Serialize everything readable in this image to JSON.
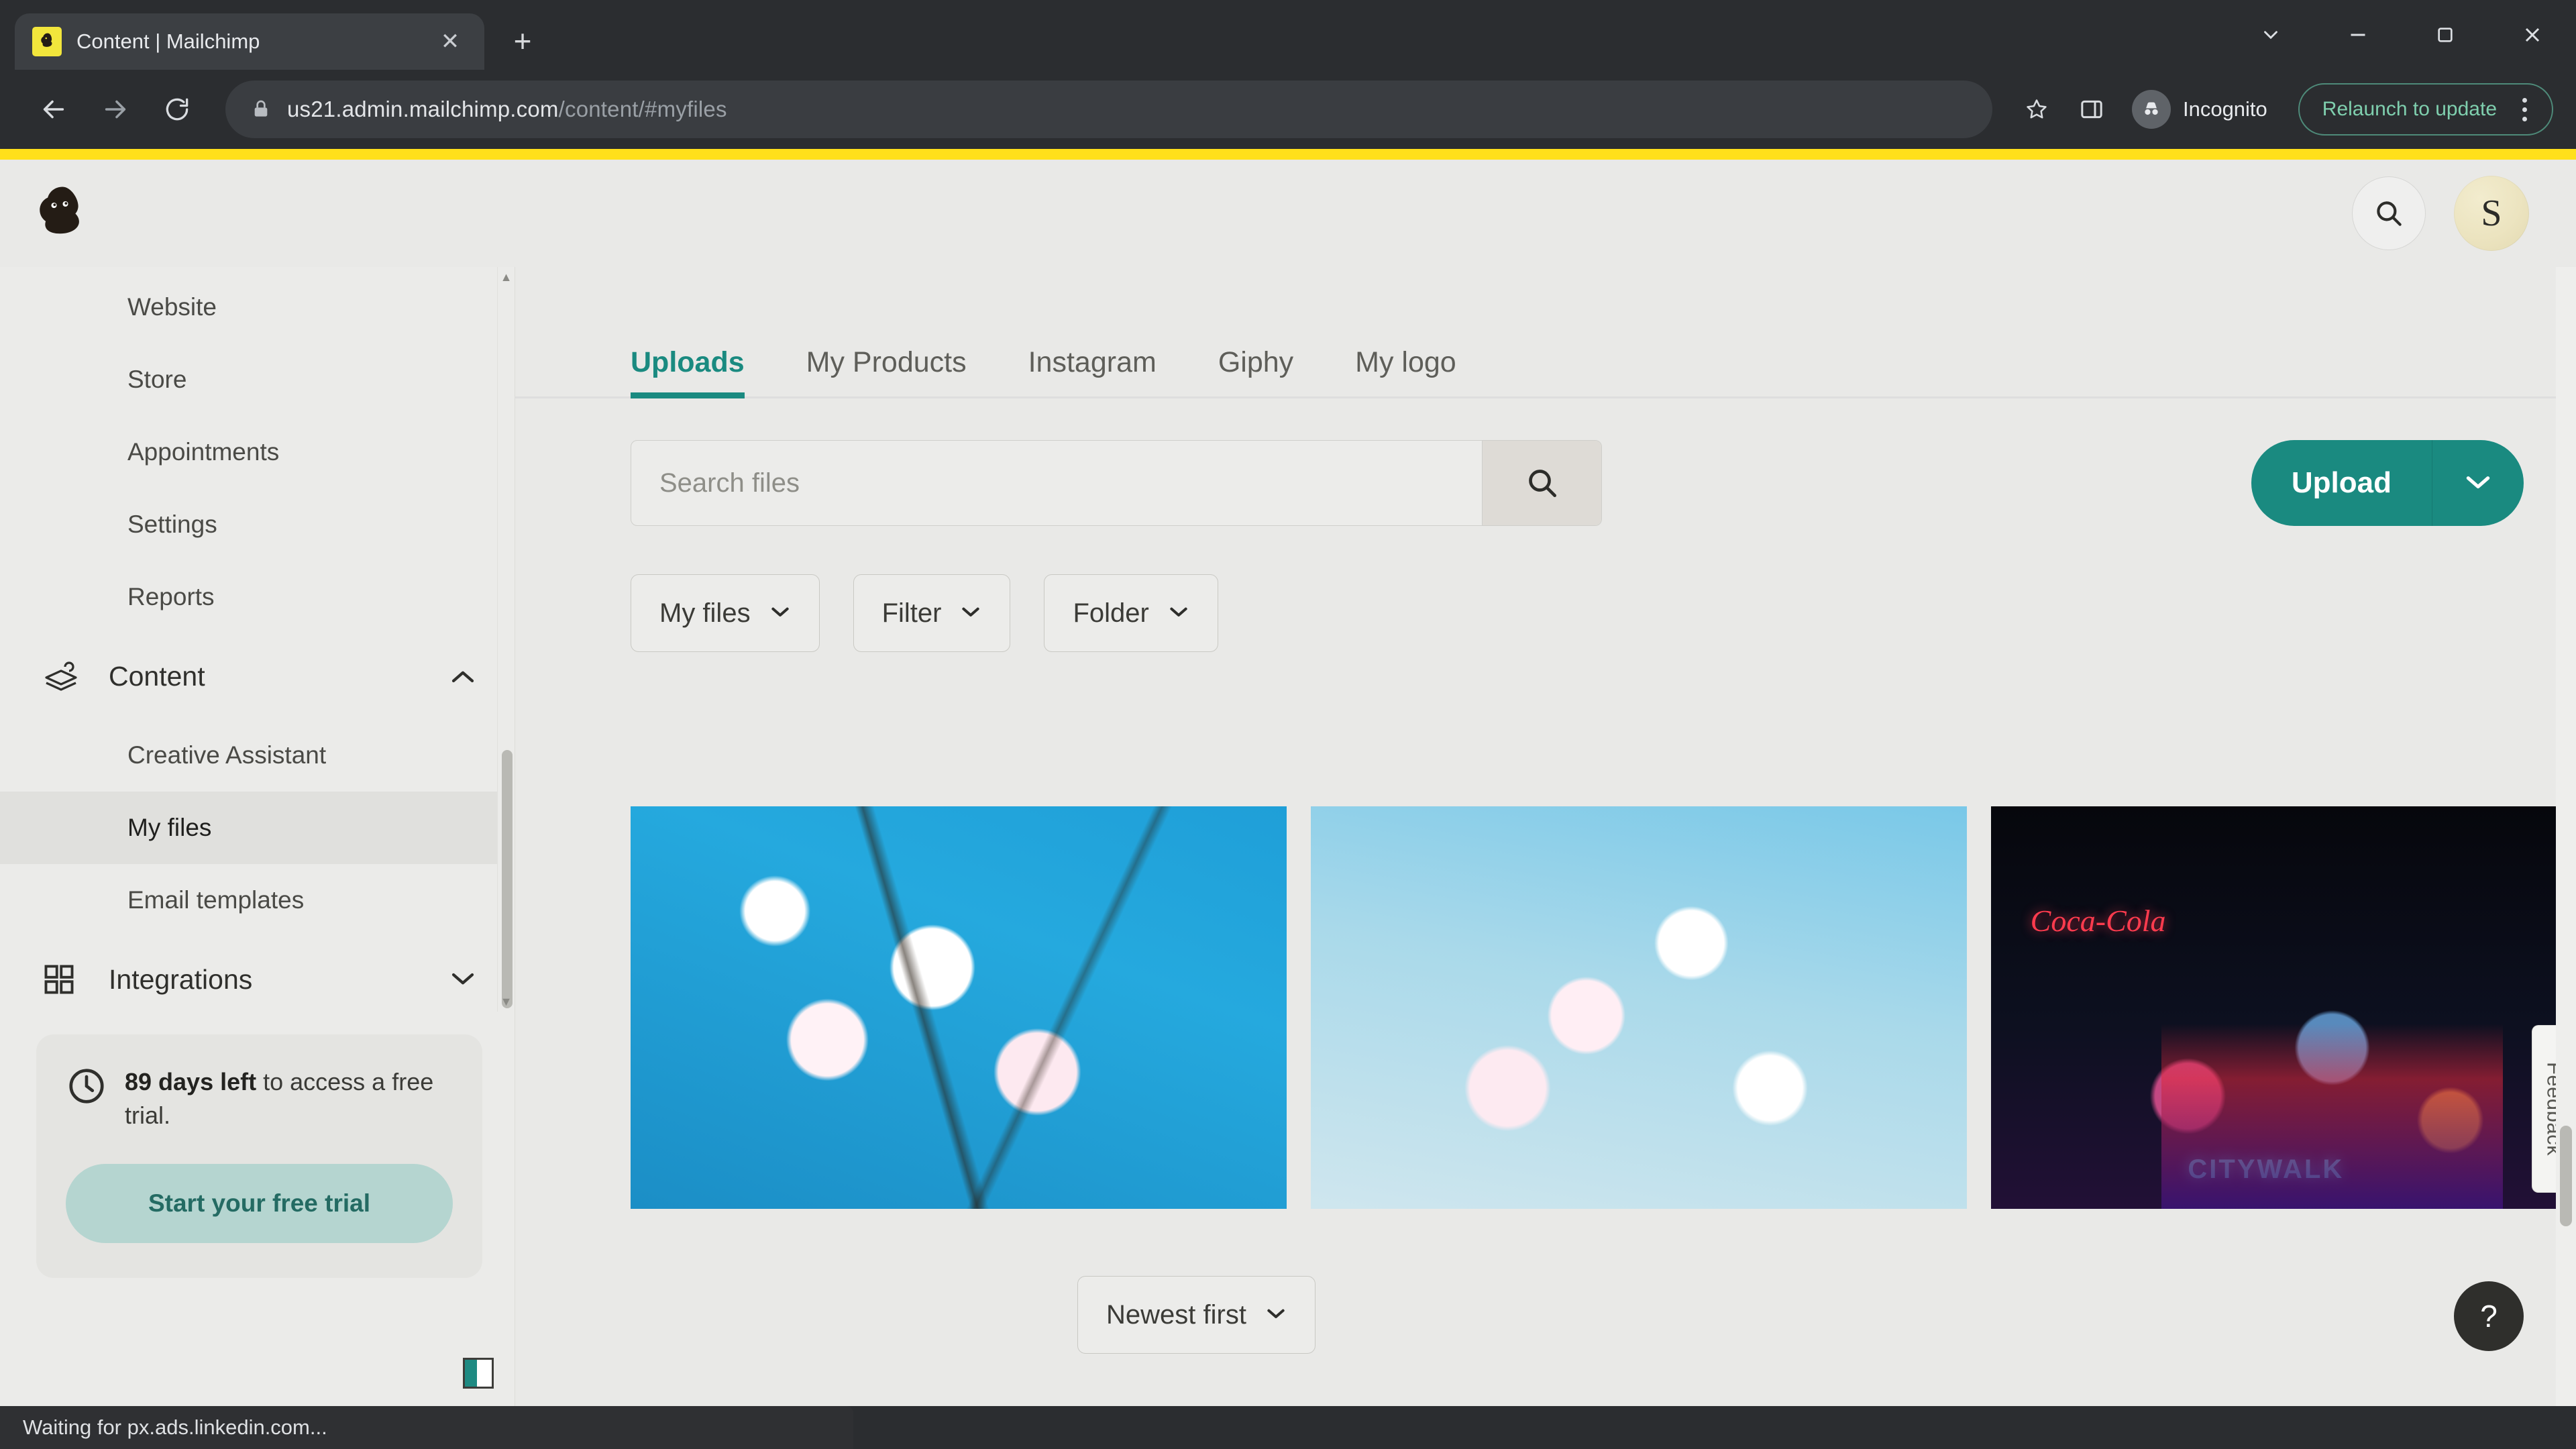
{
  "browser": {
    "tab": {
      "title": "Content | Mailchimp",
      "favicon": "mailchimp-favicon",
      "close_label": "✕"
    },
    "new_tab_label": "+",
    "window_controls": {
      "minimize_group": "⌄",
      "minimize": "−",
      "maximize": "❐",
      "close": "✕"
    },
    "nav": {
      "back": "←",
      "forward": "→",
      "reload": "↻"
    },
    "omnibox": {
      "lock_icon": "lock-icon",
      "url_host": "us21.admin.mailchimp.com",
      "url_path": "/content/#myfiles",
      "bookmark_star": "☆"
    },
    "profile": {
      "label": "Incognito",
      "icon": "incognito-icon"
    },
    "relaunch": {
      "label": "Relaunch to update"
    },
    "menu_icon": "kebab-menu-icon",
    "status": "Waiting for px.ads.linkedin.com..."
  },
  "app": {
    "logo": "mailchimp-freddie-logo",
    "search_icon": "search-icon",
    "avatar_initial": "S"
  },
  "sidebar": {
    "items": [
      {
        "label": "Website"
      },
      {
        "label": "Store"
      },
      {
        "label": "Appointments"
      },
      {
        "label": "Settings"
      },
      {
        "label": "Reports"
      }
    ],
    "content_group": {
      "label": "Content",
      "icon": "content-icon",
      "chevron": "⌃",
      "expanded": true
    },
    "content_children": [
      {
        "label": "Creative Assistant",
        "active": false
      },
      {
        "label": "My files",
        "active": true
      },
      {
        "label": "Email templates",
        "active": false
      }
    ],
    "integrations_group": {
      "label": "Integrations",
      "icon": "grid-icon",
      "chevron": "⌄",
      "expanded": false
    },
    "trial": {
      "icon": "clock-icon",
      "days": "89 days left",
      "text": " to access a free trial.",
      "button": "Start your free trial"
    }
  },
  "main": {
    "tabs": [
      {
        "label": "Uploads",
        "active": true
      },
      {
        "label": "My Products",
        "active": false
      },
      {
        "label": "Instagram",
        "active": false
      },
      {
        "label": "Giphy",
        "active": false
      },
      {
        "label": "My logo",
        "active": false
      }
    ],
    "search": {
      "value": "",
      "placeholder": "Search files",
      "button_icon": "search-icon"
    },
    "upload": {
      "label": "Upload",
      "caret": "⌄"
    },
    "filters": [
      {
        "label": "My files",
        "caret": "⌄"
      },
      {
        "label": "Filter",
        "caret": "⌄"
      },
      {
        "label": "Folder",
        "caret": "⌄"
      }
    ],
    "gallery": [
      {
        "name": "cherry-blossom-blue-sky",
        "neon": "",
        "cola": ""
      },
      {
        "name": "cherry-blossom-branches",
        "neon": "",
        "cola": ""
      },
      {
        "name": "citywalk-night-neon",
        "neon": "CITYWALK",
        "cola": "Coca-Cola"
      }
    ],
    "sort": {
      "label": "Newest first",
      "caret": "⌄"
    },
    "feedback_tab": "Feedback",
    "help_button": "?"
  },
  "colors": {
    "accent_teal": "#1a8a80",
    "brand_yellow": "#ffe01b",
    "trial_button": "#b5d5d0",
    "chrome_dark": "#2b2d30"
  }
}
